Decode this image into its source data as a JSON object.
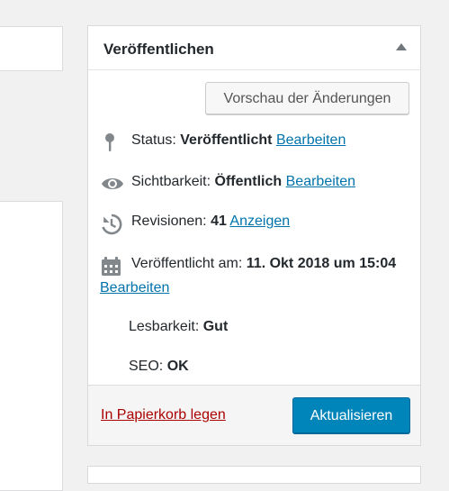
{
  "box": {
    "title": "Veröffentlichen",
    "preview_button": "Vorschau der Änderungen",
    "status": {
      "label": "Status:",
      "value": "Veröffentlicht",
      "edit": "Bearbeiten"
    },
    "visibility": {
      "label": "Sichtbarkeit:",
      "value": "Öffentlich",
      "edit": "Bearbeiten"
    },
    "revisions": {
      "label": "Revisionen:",
      "value": "41",
      "link": "Anzeigen"
    },
    "published": {
      "label": "Veröffentlicht am:",
      "value": "11. Okt 2018 um 15:04",
      "edit": "Bearbeiten"
    },
    "readability": {
      "label": "Lesbarkeit:",
      "value": "Gut"
    },
    "seo": {
      "label": "SEO:",
      "value": "OK"
    },
    "trash_link": "In Papierkorb legen",
    "update_button": "Aktualisieren"
  },
  "icons": {
    "status": "pin-icon",
    "visibility": "eye-icon",
    "revisions": "history-icon",
    "published": "calendar-icon",
    "toggle": "triangle-up-icon"
  },
  "colors": {
    "link": "#0073aa",
    "trash": "#a00000",
    "primary_button": "#0085ba"
  }
}
